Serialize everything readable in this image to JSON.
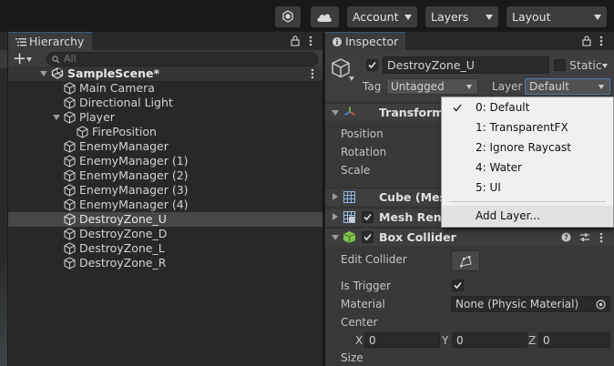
{
  "toolbar": {
    "account_label": "Account",
    "layers_label": "Layers",
    "layout_label": "Layout"
  },
  "hierarchy": {
    "tab_label": "Hierarchy",
    "search_placeholder": "All",
    "scene_name": "SampleScene*",
    "items": [
      {
        "label": "Main Camera"
      },
      {
        "label": "Directional Light"
      },
      {
        "label": "Player"
      },
      {
        "label": "FirePosition"
      },
      {
        "label": "EnemyManager"
      },
      {
        "label": "EnemyManager (1)"
      },
      {
        "label": "EnemyManager (2)"
      },
      {
        "label": "EnemyManager (3)"
      },
      {
        "label": "EnemyManager (4)"
      },
      {
        "label": "DestroyZone_U"
      },
      {
        "label": "DestroyZone_D"
      },
      {
        "label": "DestroyZone_L"
      },
      {
        "label": "DestroyZone_R"
      }
    ],
    "selected": "DestroyZone_U"
  },
  "inspector": {
    "tab_label": "Inspector",
    "object_name": "DestroyZone_U",
    "static_label": "Static",
    "tag_label": "Tag",
    "tag_value": "Untagged",
    "layer_label": "Layer",
    "layer_value": "Default",
    "transform": {
      "title": "Transform",
      "position_label": "Position",
      "rotation_label": "Rotation",
      "scale_label": "Scale"
    },
    "cube_mesh_title": "Cube (Mesh",
    "mesh_renderer_title": "Mesh Rende",
    "box_collider": {
      "title": "Box Collider",
      "edit_collider_label": "Edit Collider",
      "is_trigger_label": "Is Trigger",
      "is_trigger": true,
      "material_label": "Material",
      "material_value": "None (Physic Material)",
      "center_label": "Center",
      "center": {
        "x_label": "X",
        "x": "0",
        "y_label": "Y",
        "y": "0",
        "z_label": "Z",
        "z": "0"
      },
      "size_label": "Size"
    }
  },
  "layer_menu": {
    "items": [
      {
        "label": "0: Default",
        "checked": true
      },
      {
        "label": "1: TransparentFX",
        "checked": false
      },
      {
        "label": "2: Ignore Raycast",
        "checked": false
      },
      {
        "label": "4: Water",
        "checked": false
      },
      {
        "label": "5: UI",
        "checked": false
      }
    ],
    "add_layer_label": "Add Layer..."
  },
  "colors": {
    "selection": "#2c5d87",
    "header": "#3e3e3e",
    "menu_bg": "#f0f0f0",
    "accent": "#4c7eb6"
  }
}
